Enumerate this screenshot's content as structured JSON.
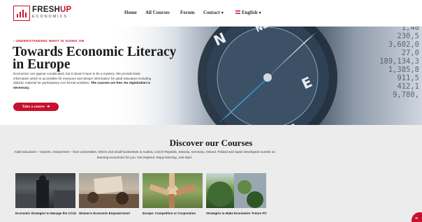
{
  "brand": {
    "name_part1": "FRESH",
    "name_part2": "UP",
    "subtitle": "ECONOMICS",
    "accent_color": "#c8102e"
  },
  "nav": {
    "items": [
      {
        "label": "Home"
      },
      {
        "label": "All Courses"
      },
      {
        "label": "Forum"
      },
      {
        "label": "Contact",
        "chevron": "chevron-down-icon"
      },
      {
        "label": "English",
        "chevron": "chevron-down-icon",
        "icon": "uk-flag-icon"
      }
    ]
  },
  "hero": {
    "eyebrow": "› UNDERSTANDING WHAT IS GOING ON",
    "title": "Towards Economic Literacy in Europe",
    "description": "Economics can appear complicated, but it doesn't have to be a mystery. We provide basic information which is accessible for everyone and deeper information for adult educators including didactic material for participatory non-formal activities.",
    "description_bold": "The courses are free. No registration is necessary.",
    "cta_label": "Take a course",
    "cta_icon": "arrow-right-icon",
    "background_numbers": [
      "1,40",
      "230,5",
      "3,602,0",
      "27,0",
      "189,134,3",
      "1,385,8",
      "911,5",
      "412,1",
      "9,780,"
    ]
  },
  "courses": {
    "title": "Discover our Courses",
    "description": "Adult educators – trainers, researchers – from universities, NGOs and small businesses in Austria, Czech Republic, Estonia, Germany, Ireland, Poland and Spain developed courses on learning economics for you. Get inspired. Enjoy learning. Just start.",
    "items": [
      {
        "title": "Economic Strategies to Manage the Crisis"
      },
      {
        "title": "Women's Economic Empowerment"
      },
      {
        "title": "Europe: Competition or Cooperation"
      },
      {
        "title": "Strategies to Make Economies 'Future Fit'"
      }
    ]
  },
  "chat": {
    "icon": "chat-icon"
  }
}
